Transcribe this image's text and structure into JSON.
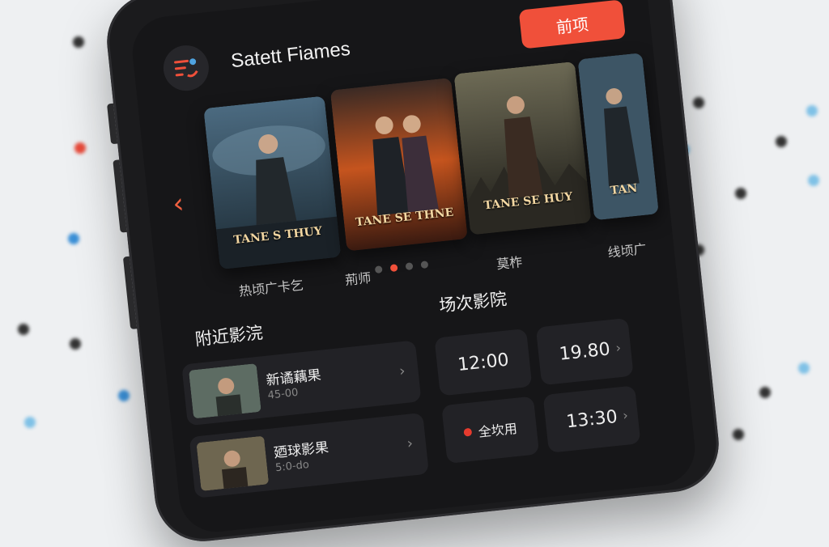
{
  "app": {
    "title": "Satett Fiames",
    "action_button_label": "前项"
  },
  "carousel": {
    "posters": [
      {
        "title": "TANE S THUY",
        "label": "热顷广卡乞"
      },
      {
        "title": "TANE SE THNE",
        "label": "荊师"
      },
      {
        "title": "TANE SE HUY",
        "label": "莫柞"
      },
      {
        "title": "TAN",
        "label": "线顷广"
      }
    ],
    "page_count": 4,
    "active_page": 1
  },
  "nearby": {
    "heading": "附近影浣",
    "cinemas": [
      {
        "name": "新谲藕果",
        "time": "45-00"
      },
      {
        "name": "廼球影果",
        "time": "5:0-do"
      }
    ]
  },
  "showtimes": {
    "heading": "场次影院",
    "slots": [
      {
        "label": "12:00",
        "has_chevron": false,
        "marked": false
      },
      {
        "label": "19.80",
        "has_chevron": true,
        "marked": false
      },
      {
        "label": "全坎用",
        "has_chevron": false,
        "marked": true
      },
      {
        "label": "13:30",
        "has_chevron": true,
        "marked": false
      }
    ]
  },
  "colors": {
    "accent": "#f0503a",
    "screen_bg": "#161618",
    "card_bg": "#222226"
  }
}
